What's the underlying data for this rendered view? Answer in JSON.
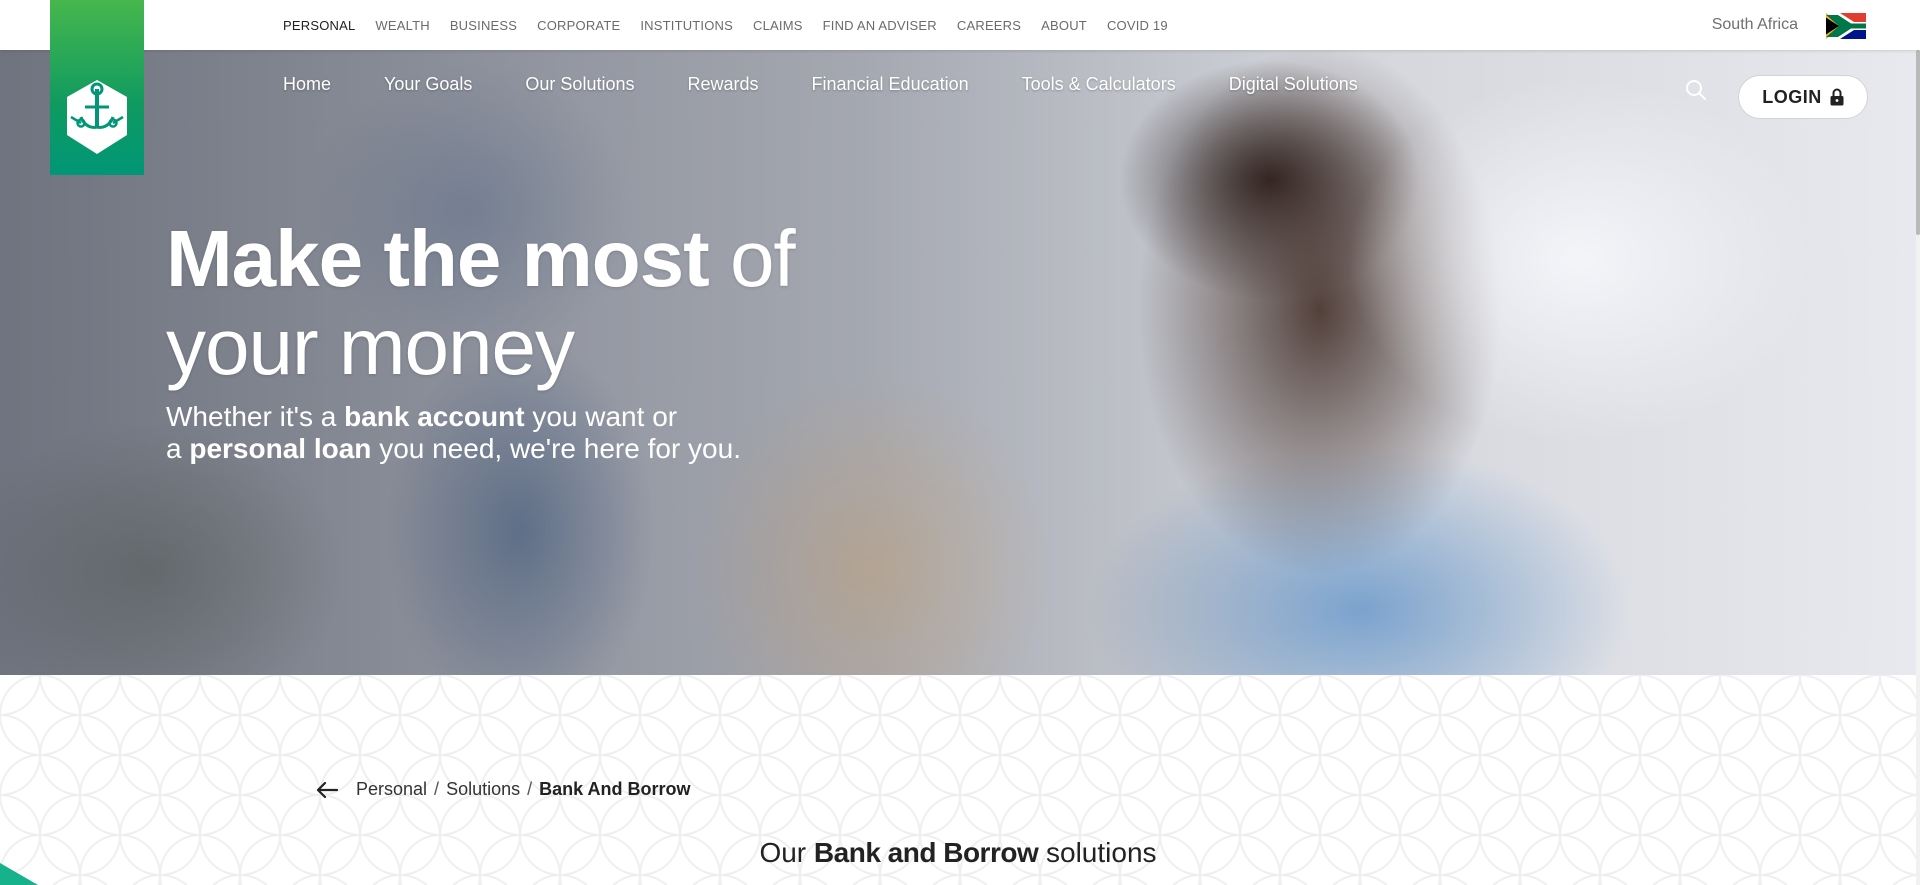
{
  "top_nav": {
    "items": [
      "PERSONAL",
      "WEALTH",
      "BUSINESS",
      "CORPORATE",
      "INSTITUTIONS",
      "CLAIMS",
      "FIND AN ADVISER",
      "CAREERS",
      "ABOUT",
      "COVID 19"
    ],
    "active": "PERSONAL"
  },
  "region": {
    "label": "South Africa",
    "flag_icon": "south-africa-flag-icon"
  },
  "main_nav": {
    "items": [
      "Home",
      "Your Goals",
      "Our Solutions",
      "Rewards",
      "Financial Education",
      "Tools & Calculators",
      "Digital Solutions"
    ]
  },
  "login": {
    "label": "LOGIN",
    "icon": "lock-icon"
  },
  "search": {
    "icon": "search-icon"
  },
  "hero": {
    "headline_bold": "Make the most",
    "headline_light_1": "of",
    "headline_light_2": "your money",
    "sub_1": "Whether it's a",
    "sub_1_bold": "bank account",
    "sub_1_end": "you want or",
    "sub_2": "a",
    "sub_2_bold": "personal loan",
    "sub_2_end": "you need, we're here for you."
  },
  "breadcrumb": {
    "back_icon": "arrow-left-icon",
    "items": [
      "Personal",
      "Solutions"
    ],
    "separator": "/",
    "current": "Bank And Borrow"
  },
  "section": {
    "title_pre": "Our",
    "title_bold": "Bank and Borrow",
    "title_post": "solutions"
  },
  "colors": {
    "brand_green": "#009677",
    "brand_light_green": "#47b74d",
    "accent_teal": "#16b28b"
  }
}
